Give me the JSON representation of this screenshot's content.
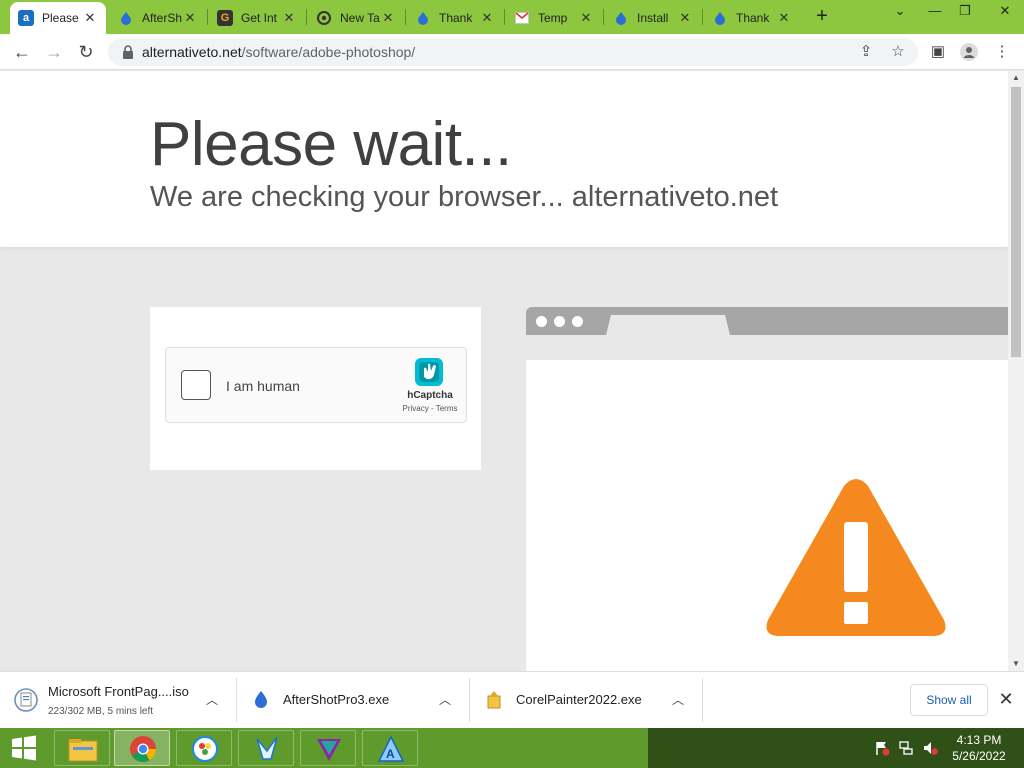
{
  "browser": {
    "tabs": [
      {
        "title": "Please",
        "favicon": "alternativeto-icon",
        "active": true
      },
      {
        "title": "AfterSh",
        "favicon": "droplet-icon"
      },
      {
        "title": "Get Int",
        "favicon": "g-icon"
      },
      {
        "title": "New Ta",
        "favicon": "chrome-icon"
      },
      {
        "title": "Thank",
        "favicon": "droplet-icon"
      },
      {
        "title": "Temp",
        "favicon": "gmail-icon"
      },
      {
        "title": "Install",
        "favicon": "droplet-icon"
      },
      {
        "title": "Thank",
        "favicon": "droplet-icon"
      }
    ],
    "new_tab_label": "+",
    "url_host": "alternativeto.net",
    "url_path": "/software/adobe-photoshop/"
  },
  "page": {
    "heading": "Please wait...",
    "subheading": "We are checking your browser... alternativeto.net",
    "captcha": {
      "checkbox_label": "I am human",
      "brand": "hCaptcha",
      "links": "Privacy - Terms"
    }
  },
  "downloads": {
    "items": [
      {
        "name": "Microsoft FrontPag....iso",
        "status": "223/302 MB, 5 mins left",
        "icon": "disc-image-icon"
      },
      {
        "name": "AfterShotPro3.exe",
        "status": "",
        "icon": "droplet-icon"
      },
      {
        "name": "CorelPainter2022.exe",
        "status": "",
        "icon": "installer-icon"
      }
    ],
    "show_all_label": "Show all"
  },
  "taskbar": {
    "time": "4:13 PM",
    "date": "5/26/2022"
  },
  "colors": {
    "tabstrip": "#8dc63f",
    "taskbar": "#5e9a2c",
    "warning": "#f5891f",
    "hcaptcha": "#00bcd4"
  }
}
